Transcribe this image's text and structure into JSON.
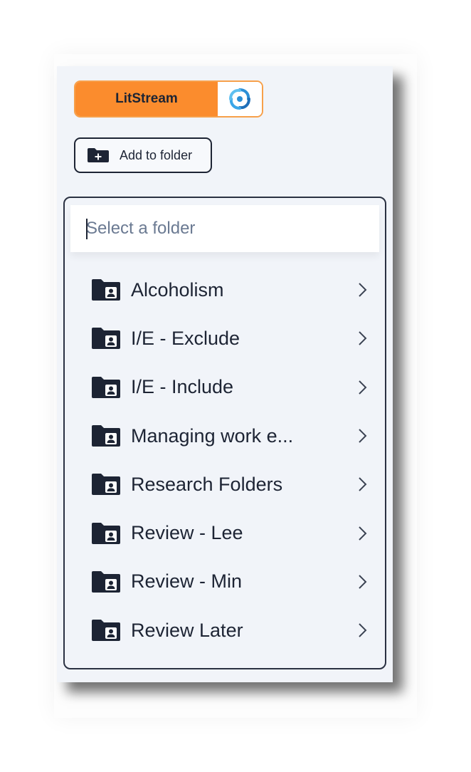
{
  "litstream": {
    "label": "LitStream",
    "logo_icon": "litstream-swirl-icon"
  },
  "toolbar": {
    "add_to_folder_label": "Add to folder",
    "add_icon": "folder-plus-icon"
  },
  "folder_picker": {
    "search_placeholder": "Select a folder",
    "search_value": "",
    "items": [
      {
        "label": "Alcoholism",
        "icon": "shared-folder-icon"
      },
      {
        "label": "I/E - Exclude",
        "icon": "shared-folder-icon"
      },
      {
        "label": "I/E - Include",
        "icon": "shared-folder-icon"
      },
      {
        "label": "Managing work e...",
        "icon": "shared-folder-icon"
      },
      {
        "label": "Research Folders",
        "icon": "shared-folder-icon"
      },
      {
        "label": "Review - Lee",
        "icon": "shared-folder-icon"
      },
      {
        "label": "Review - Min",
        "icon": "shared-folder-icon"
      },
      {
        "label": "Review Later",
        "icon": "shared-folder-icon"
      }
    ]
  },
  "colors": {
    "accent_orange": "#fb8c2d",
    "dark_navy": "#1d2434",
    "panel_bg": "#f1f4f9"
  }
}
